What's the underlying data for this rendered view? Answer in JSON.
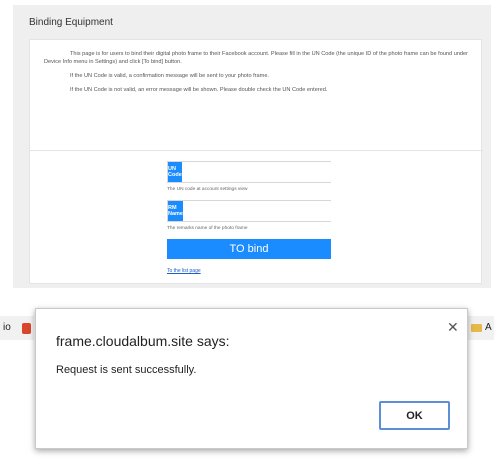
{
  "page": {
    "title": "Binding Equipment",
    "description": [
      "This page is for users to bind their digital photo frame to their Facebook account. Please fill in the UN Code (the unique ID of the photo frame can be found under Device Info menu in Settings) and click [To bind] button.",
      "If the UN Code is valid, a confirmation message will be sent to your photo frame.",
      "If the UN Code is not valid, an error message will be shown. Please double check the UN Code entered."
    ]
  },
  "form": {
    "un_code_label": "UN Code",
    "un_code_value": "",
    "un_code_hint": "The UN code at account settings view",
    "rm_name_label": "RM Name",
    "rm_name_value": "",
    "rm_name_hint": "The remarks name of the photo frame",
    "bind_button": "TO bind",
    "list_link": "To the list page"
  },
  "browser": {
    "left_fragment": "io",
    "right_fragment": "A"
  },
  "dialog": {
    "title": "frame.cloudalbum.site says:",
    "message": "Request is sent successfully.",
    "ok_label": "OK",
    "close_icon": "close-icon"
  },
  "colors": {
    "accent": "#1a8cff",
    "panel_bg": "#efefef",
    "ok_border": "#5b8fd6"
  }
}
